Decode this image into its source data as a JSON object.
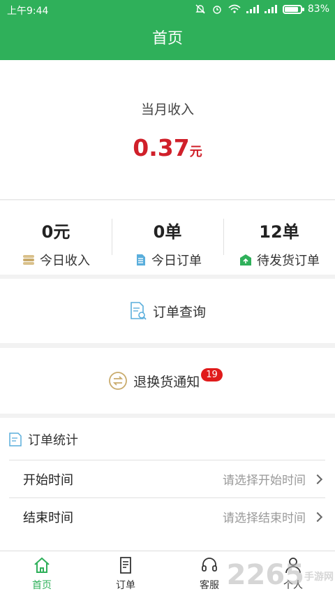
{
  "status": {
    "time": "上午9:44",
    "battery": "83%"
  },
  "header": {
    "title": "首页"
  },
  "income": {
    "label": "当月收入",
    "amount": "0.37",
    "unit": "元"
  },
  "stats": [
    {
      "value": "0元",
      "label": "今日收入",
      "icon": "coins-icon"
    },
    {
      "value": "0单",
      "label": "今日订单",
      "icon": "document-icon"
    },
    {
      "value": "12单",
      "label": "待发货订单",
      "icon": "package-icon"
    }
  ],
  "actions": {
    "query_label": "订单查询",
    "return_label": "退换货通知",
    "return_badge": "19"
  },
  "order_stats": {
    "title": "订单统计",
    "start_label": "开始时间",
    "start_placeholder": "请选择开始时间",
    "end_label": "结束时间",
    "end_placeholder": "请选择结束时间"
  },
  "tabs": [
    {
      "label": "首页",
      "icon": "home-icon",
      "active": true
    },
    {
      "label": "订单",
      "icon": "orders-icon",
      "active": false
    },
    {
      "label": "客服",
      "icon": "headset-icon",
      "active": false
    },
    {
      "label": "个人",
      "icon": "user-icon",
      "active": false
    }
  ],
  "watermark": {
    "brand": "2265",
    "site": "手游网"
  },
  "colors": {
    "accent": "#2fb05a",
    "income": "#d0202a",
    "badge": "#e01b1b"
  }
}
